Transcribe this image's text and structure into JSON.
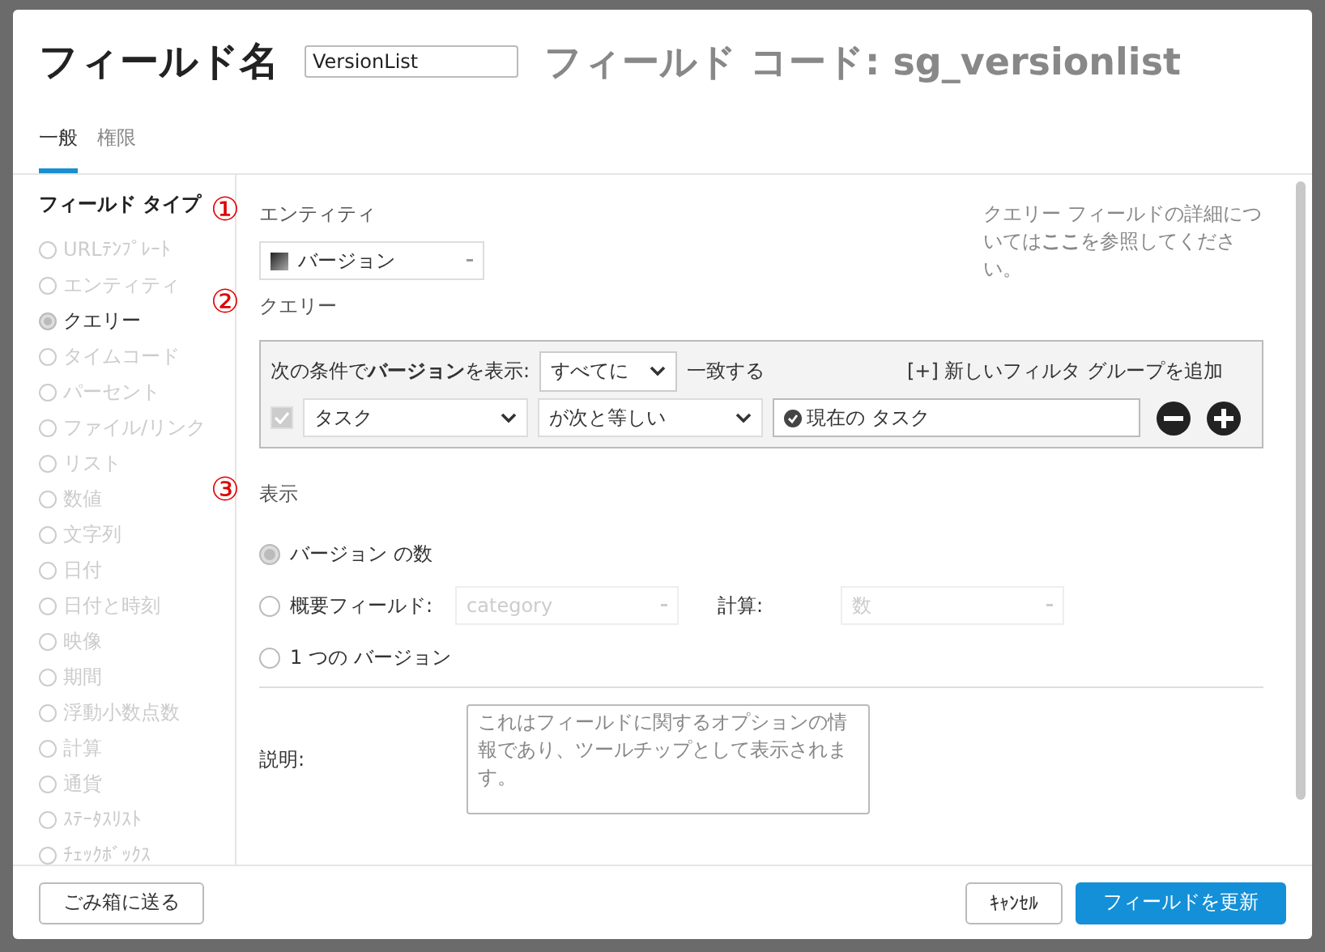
{
  "dialog": {
    "title": "フィールド名",
    "name_value": "VersionList",
    "field_code": "フィールド コード: sg_versionlist"
  },
  "tabs": [
    {
      "label": "一般",
      "selected": true
    },
    {
      "label": "権限",
      "selected": false
    }
  ],
  "sidebar": {
    "title": "フィールド タイプ",
    "items": [
      {
        "label": "URLﾃﾝﾌﾟﾚｰﾄ",
        "selected": false
      },
      {
        "label": "エンティティ",
        "selected": false
      },
      {
        "label": "クエリー",
        "selected": true
      },
      {
        "label": "タイムコード",
        "selected": false
      },
      {
        "label": "パーセント",
        "selected": false
      },
      {
        "label": "ファイル/リンク",
        "selected": false
      },
      {
        "label": "リスト",
        "selected": false
      },
      {
        "label": "数値",
        "selected": false
      },
      {
        "label": "文字列",
        "selected": false
      },
      {
        "label": "日付",
        "selected": false
      },
      {
        "label": "日付と時刻",
        "selected": false
      },
      {
        "label": "映像",
        "selected": false
      },
      {
        "label": "期間",
        "selected": false
      },
      {
        "label": "浮動小数点数",
        "selected": false
      },
      {
        "label": "計算",
        "selected": false
      },
      {
        "label": "通貨",
        "selected": false
      },
      {
        "label": "ｽﾃｰﾀｽﾘｽﾄ",
        "selected": false
      },
      {
        "label": "ﾁｪｯｸﾎﾞｯｸｽ",
        "selected": false
      }
    ]
  },
  "sections": [
    {
      "marker": "①",
      "title": "エンティティ"
    },
    {
      "marker": "②",
      "title": "クエリー"
    },
    {
      "marker": "③",
      "title": "表示"
    }
  ],
  "entity_select": {
    "value": "バージョン"
  },
  "help_text": "クエリー フィールドの詳細については**ここ**を参照してください。",
  "query": {
    "prefix": "次の条件で**バージョン**を表示:",
    "match_select": "すべてに",
    "suffix": "一致する",
    "add_group_link": "[+] 新しいフィルタ グループを追加",
    "filter": {
      "checked": true,
      "field": "タスク",
      "operator": "が次と等しい",
      "value": "現在の タスク"
    }
  },
  "display": [
    {
      "kind": "plain",
      "label": "バージョン の数",
      "selected": true
    },
    {
      "kind": "summary",
      "label": "概要フィールド:",
      "selected": false,
      "field_select": "category",
      "calc_label": "計算:",
      "calc_select": "数"
    },
    {
      "kind": "plain",
      "label": "1 つの バージョン",
      "selected": false
    }
  ],
  "description": {
    "label": "説明:",
    "placeholder": "これはフィールドに関するオプションの情報であり、ツールチップとして表示されます。"
  },
  "footer": {
    "trash_button": "ごみ箱に送る",
    "cancel_button": "ｷｬﾝｾﾙ",
    "update_button": "フィールドを更新"
  }
}
